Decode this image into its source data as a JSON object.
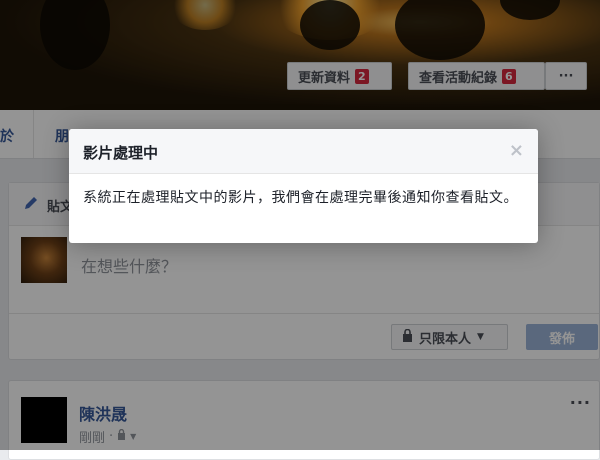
{
  "cover": {
    "update_info": {
      "label": "更新資料",
      "badge": "2"
    },
    "activity_log": {
      "label": "查看活動紀錄",
      "badge": "6"
    },
    "more": "···"
  },
  "nav": {
    "tab_partial_1": "於",
    "tab_partial_2": "朋"
  },
  "composer": {
    "tab_label": "貼文",
    "placeholder": "在想些什麼？",
    "privacy": "只限本人",
    "post_button": "發佈"
  },
  "feed_post": {
    "author": "陳洪晟",
    "time": "剛剛",
    "more": "···"
  },
  "dialog": {
    "title": "影片處理中",
    "close": "×",
    "message": "系統正在處理貼文中的影片，我們會在處理完畢後通知你查看貼文。"
  },
  "colors": {
    "link": "#365899",
    "badge": "#d6293e",
    "post_button": "#9cb4d8",
    "overlay": "rgba(0,0,0,0.42)"
  }
}
